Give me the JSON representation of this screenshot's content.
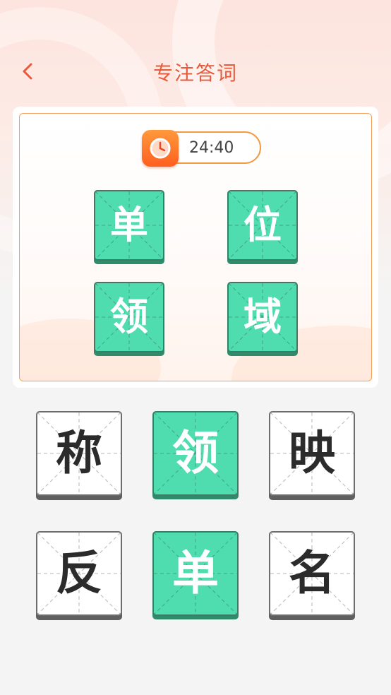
{
  "header": {
    "title": "专注答词",
    "back_icon": "chevron-left-icon"
  },
  "timer": {
    "icon": "clock-icon",
    "value": "24:40"
  },
  "answer_slots": [
    {
      "char": "单"
    },
    {
      "char": "位"
    },
    {
      "char": "领"
    },
    {
      "char": "域"
    }
  ],
  "choices": [
    {
      "char": "称",
      "selected": false
    },
    {
      "char": "领",
      "selected": true
    },
    {
      "char": "映",
      "selected": false
    },
    {
      "char": "反",
      "selected": false
    },
    {
      "char": "单",
      "selected": true
    },
    {
      "char": "名",
      "selected": false
    }
  ],
  "colors": {
    "accent": "#e75a3c",
    "timer_border": "#f29a44",
    "tile_green": "#4fdcae",
    "tile_green_shadow": "#2f8c6b",
    "tile_white": "#ffffff"
  }
}
